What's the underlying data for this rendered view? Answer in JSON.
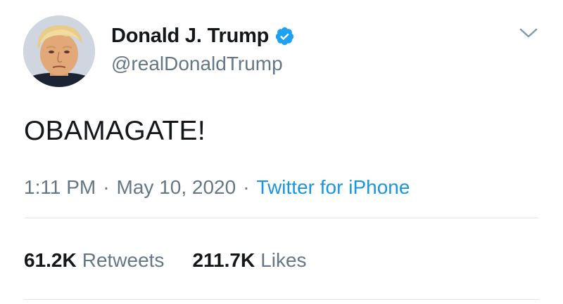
{
  "author": {
    "display_name": "Donald J. Trump",
    "handle": "@realDonaldTrump",
    "verified": true,
    "avatar_icon": "profile-photo"
  },
  "tweet": {
    "text": "OBAMAGATE!"
  },
  "meta": {
    "time": "1:11 PM",
    "separator_1": "·",
    "date": "May 10, 2020",
    "separator_2": "·",
    "source": "Twitter for iPhone"
  },
  "stats": {
    "retweets_count": "61.2K",
    "retweets_label": "Retweets",
    "likes_count": "211.7K",
    "likes_label": "Likes"
  },
  "colors": {
    "verified_blue": "#1da1f2",
    "link_blue": "#1b95e0",
    "secondary_text": "#657786",
    "divider": "#e1e8ed"
  }
}
